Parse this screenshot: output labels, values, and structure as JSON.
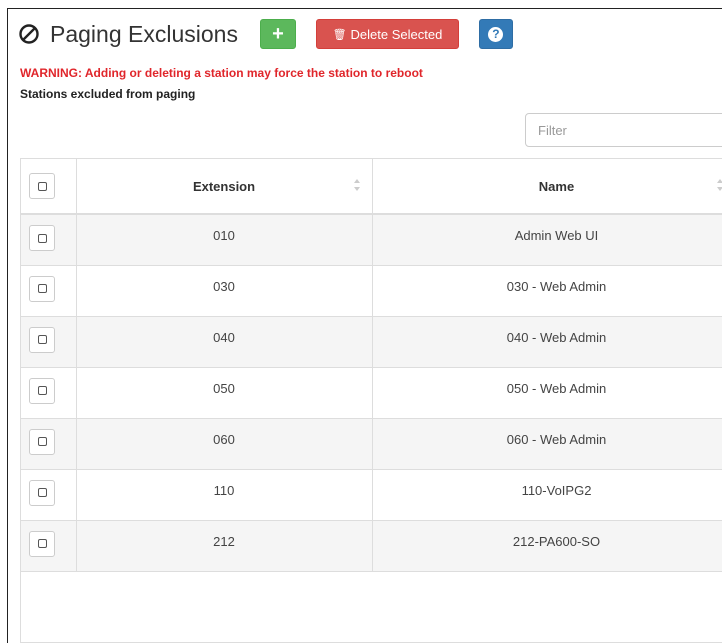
{
  "header": {
    "title": "Paging Exclusions",
    "add_label": "+",
    "delete_label": "Delete Selected",
    "help_label": "?"
  },
  "warning": "WARNING: Adding or deleting a station may force the station to reboot",
  "subtitle": "Stations excluded from paging",
  "filter": {
    "placeholder": "Filter",
    "value": ""
  },
  "table": {
    "columns": [
      "Extension",
      "Name"
    ],
    "rows": [
      {
        "extension": "010",
        "name": "Admin Web UI"
      },
      {
        "extension": "030",
        "name": "030 - Web Admin"
      },
      {
        "extension": "040",
        "name": "040 - Web Admin"
      },
      {
        "extension": "050",
        "name": "050 - Web Admin"
      },
      {
        "extension": "060",
        "name": "060 - Web Admin"
      },
      {
        "extension": "110",
        "name": "110-VoIPG2"
      },
      {
        "extension": "212",
        "name": "212-PA600-SO"
      }
    ]
  },
  "colors": {
    "add": "#5cb85c",
    "delete": "#d9534f",
    "help": "#337ab7",
    "warning": "#e0262b"
  },
  "icons": {
    "title": "ban-icon",
    "delete": "trash-icon",
    "help": "question-circle-icon",
    "sort": "sort-icon"
  }
}
